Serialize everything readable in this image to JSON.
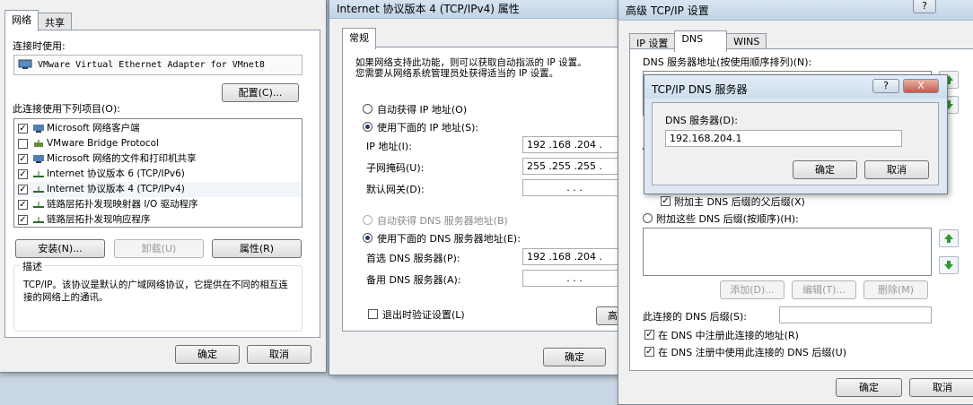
{
  "win1": {
    "tabs": [
      "网络",
      "共享"
    ],
    "connect_using_label": "连接时使用:",
    "adapter_name": "VMware Virtual Ethernet Adapter for VMnet8",
    "configure_button": "配置(C)...",
    "items_label": "此连接使用下列项目(O):",
    "items": [
      {
        "label": "Microsoft 网络客户端",
        "checked": true,
        "icon": "network-client-icon"
      },
      {
        "label": "VMware Bridge Protocol",
        "checked": false,
        "icon": "protocol-icon"
      },
      {
        "label": "Microsoft 网络的文件和打印机共享",
        "checked": true,
        "icon": "file-printer-share-icon"
      },
      {
        "label": "Internet 协议版本 6 (TCP/IPv6)",
        "checked": true,
        "icon": "protocol-icon"
      },
      {
        "label": "Internet 协议版本 4 (TCP/IPv4)",
        "checked": true,
        "icon": "protocol-icon"
      },
      {
        "label": "链路层拓扑发现映射器 I/O 驱动程序",
        "checked": true,
        "icon": "protocol-icon"
      },
      {
        "label": "链路层拓扑发现响应程序",
        "checked": true,
        "icon": "protocol-icon"
      }
    ],
    "install_button": "安装(N)...",
    "uninstall_button": "卸载(U)",
    "properties_button": "属性(R)",
    "description_title": "描述",
    "description_text": "TCP/IP。该协议是默认的广域网络协议，它提供在不同的相互连接的网络上的通讯。",
    "ok_button": "确定",
    "cancel_button": "取消"
  },
  "win2": {
    "title": "Internet 协议版本 4 (TCP/IPv4) 属性",
    "tab": "常规",
    "intro_line1": "如果网络支持此功能，则可以获取自动指派的 IP 设置。",
    "intro_line2": "您需要从网络系统管理员处获得适当的 IP 设置。",
    "auto_ip": "自动获得 IP 地址(O)",
    "manual_ip": "使用下面的 IP 地址(S):",
    "ip_label": "IP 地址(I):",
    "ip_value": "192 .168 .204 .",
    "mask_label": "子网掩码(U):",
    "mask_value": "255 .255 .255 .",
    "gateway_label": "默认网关(D):",
    "gateway_value": ".      .      .",
    "auto_dns": "自动获得 DNS 服务器地址(B)",
    "manual_dns": "使用下面的 DNS 服务器地址(E):",
    "preferred_dns_label": "首选 DNS 服务器(P):",
    "preferred_dns_value": "192 .168 .204 .",
    "alternate_dns_label": "备用 DNS 服务器(A):",
    "alternate_dns_value": ".      .      .",
    "validate_label": "退出时验证设置(L)",
    "advanced_button": "高",
    "ok_button": "确定"
  },
  "win3": {
    "title": "高级 TCP/IP 设置",
    "help_button": "?",
    "tabs": [
      "IP 设置",
      "DNS",
      "WINS"
    ],
    "dns_list_label": "DNS 服务器地址(按使用顺序排列)(N):",
    "partial_letter": "T",
    "append_parent_label": "附加主 DNS 后缀的父后缀(X)",
    "append_these_label": "附加这些 DNS 后缀(按顺序)(H):",
    "add_button": "添加(D)...",
    "edit_button": "编辑(T)...",
    "remove_button": "删除(M)",
    "conn_suffix_label": "此连接的 DNS 后缀(S):",
    "register_label": "在 DNS 中注册此连接的地址(R)",
    "use_suffix_label": "在 DNS 注册中使用此连接的 DNS 后缀(U)",
    "ok_button": "确定",
    "cancel_button": "取消"
  },
  "dns_dialog": {
    "title": "TCP/IP DNS 服务器",
    "help_button": "?",
    "close_button": "X",
    "server_label": "DNS 服务器(D):",
    "server_value": "192.168.204.1",
    "ok_button": "确定",
    "cancel_button": "取消"
  }
}
